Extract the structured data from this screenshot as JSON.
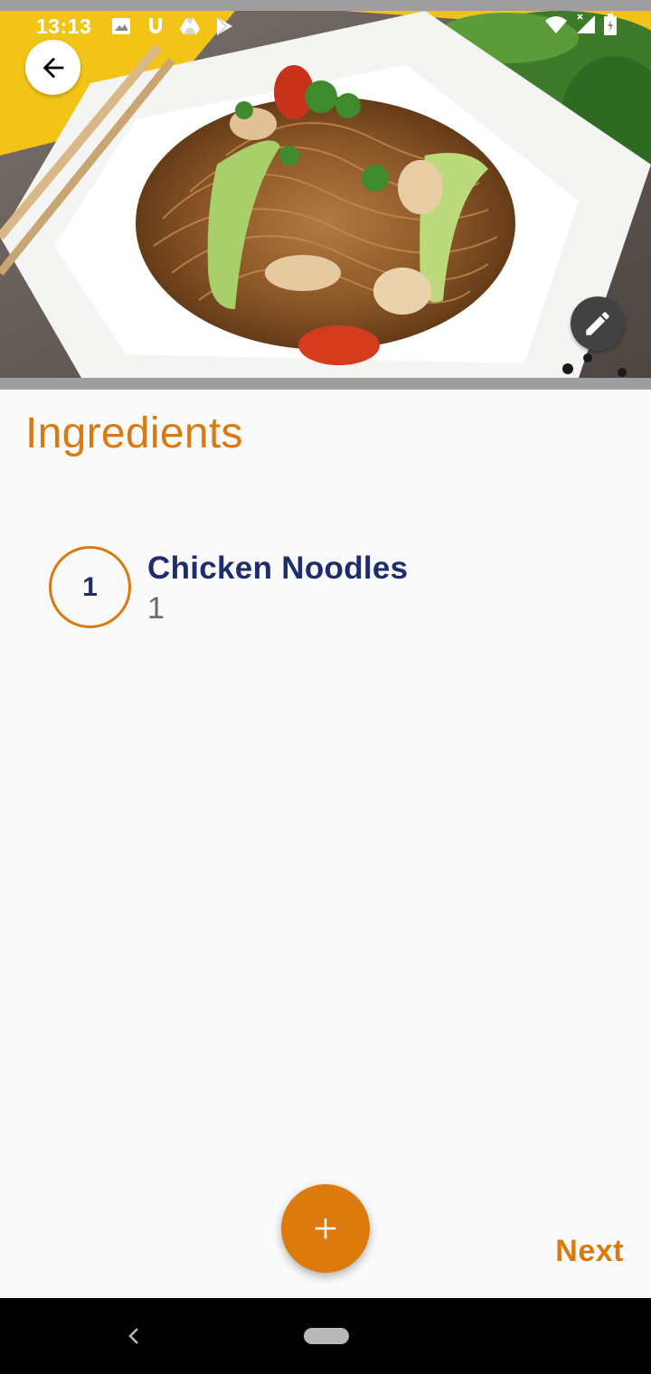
{
  "status_bar": {
    "time": "13:13",
    "left_icons": [
      "image-icon",
      "u-icon",
      "drive-icon",
      "play-store-icon"
    ],
    "right_icons": [
      "wifi-icon",
      "signal-icon",
      "battery-icon"
    ]
  },
  "header": {
    "image": "chicken-noodles-photo",
    "back_icon": "arrow-left-icon",
    "edit_icon": "pencil-icon"
  },
  "section": {
    "title": "Ingredients"
  },
  "ingredients": [
    {
      "index": "1",
      "name": "Chicken Noodles",
      "quantity": "1"
    }
  ],
  "actions": {
    "add_icon": "plus-icon",
    "next_label": "Next"
  },
  "colors": {
    "accent": "#d87a0f",
    "fab": "#dd7a0d",
    "name_text": "#1e2d6b",
    "background": "#fafafa"
  }
}
